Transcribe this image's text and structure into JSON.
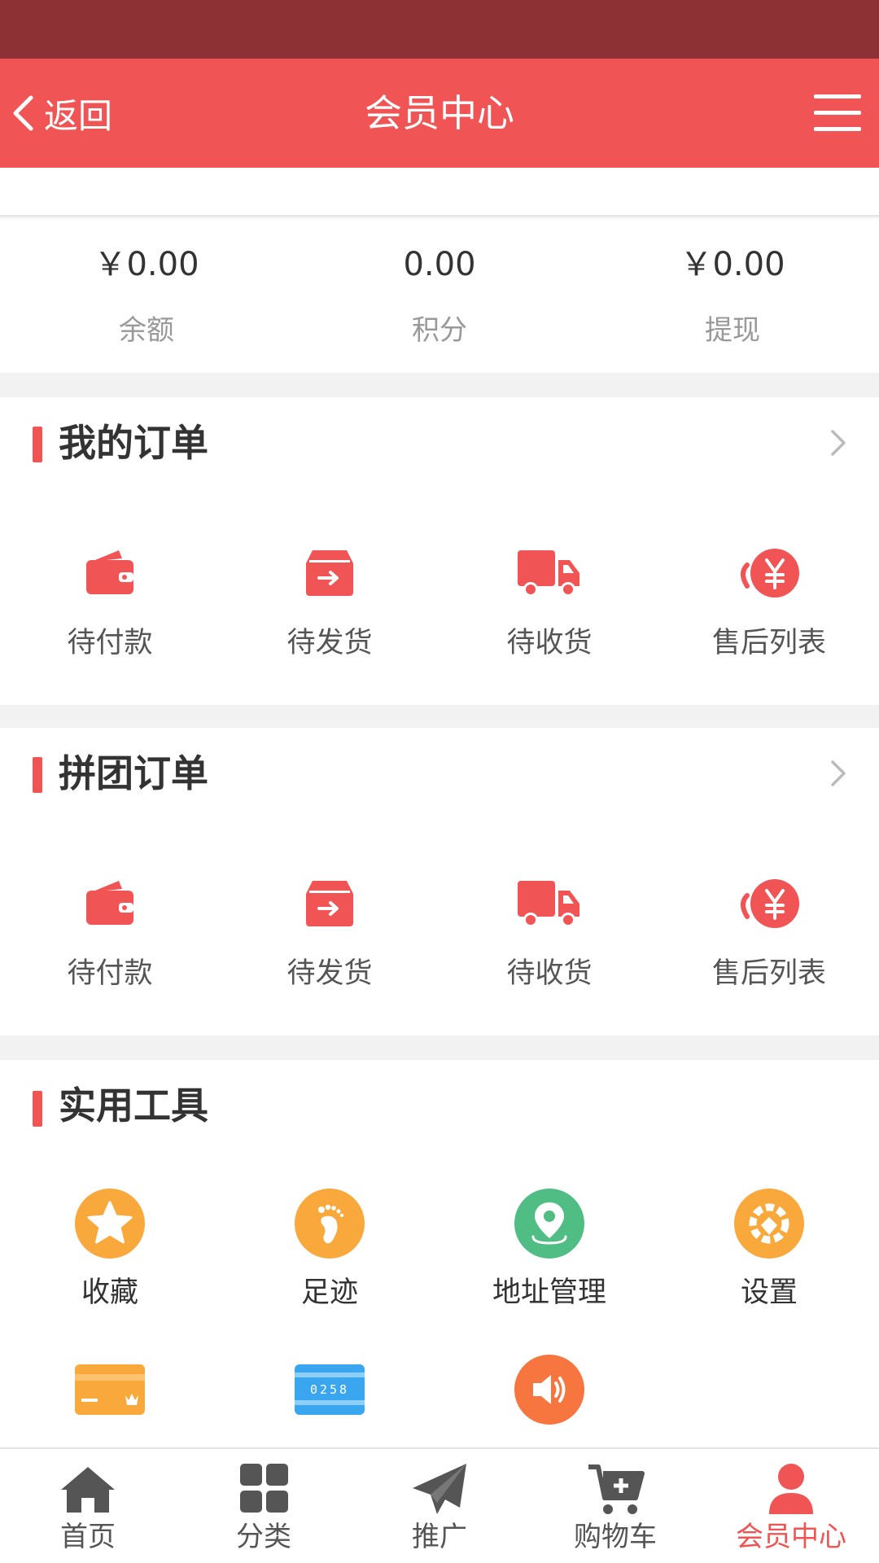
{
  "colors": {
    "accent": "#f05454",
    "statusbar": "#8e3134",
    "tool_orange": "#f9a83c",
    "tool_green": "#4fbd84",
    "tool_blue": "#3aa6f0",
    "tool_red_orange": "#f7753f"
  },
  "navbar": {
    "back_label": "返回",
    "title": "会员中心"
  },
  "stats": [
    {
      "value": "￥0.00",
      "label": "余额"
    },
    {
      "value": "0.00",
      "label": "积分"
    },
    {
      "value": "￥0.00",
      "label": "提现"
    }
  ],
  "orders": {
    "title": "我的订单",
    "items": [
      {
        "label": "待付款",
        "icon": "wallet-icon"
      },
      {
        "label": "待发货",
        "icon": "box-icon"
      },
      {
        "label": "待收货",
        "icon": "truck-icon"
      },
      {
        "label": "售后列表",
        "icon": "refund-icon"
      }
    ]
  },
  "group_orders": {
    "title": "拼团订单",
    "items": [
      {
        "label": "待付款",
        "icon": "wallet-icon"
      },
      {
        "label": "待发货",
        "icon": "box-icon"
      },
      {
        "label": "待收货",
        "icon": "truck-icon"
      },
      {
        "label": "售后列表",
        "icon": "refund-icon"
      }
    ]
  },
  "tools": {
    "title": "实用工具",
    "items": [
      {
        "label": "收藏",
        "icon": "star-icon"
      },
      {
        "label": "足迹",
        "icon": "footprint-icon"
      },
      {
        "label": "地址管理",
        "icon": "location-icon"
      },
      {
        "label": "设置",
        "icon": "settings-icon"
      }
    ],
    "more_items": [
      {
        "icon": "card-icon"
      },
      {
        "icon": "code-card-icon",
        "text": "0258"
      },
      {
        "icon": "speaker-icon"
      }
    ]
  },
  "tabbar": {
    "items": [
      {
        "label": "首页",
        "icon": "home-icon",
        "active": false
      },
      {
        "label": "分类",
        "icon": "grid-icon",
        "active": false
      },
      {
        "label": "推广",
        "icon": "paper-plane-icon",
        "active": false
      },
      {
        "label": "购物车",
        "icon": "cart-icon",
        "active": false
      },
      {
        "label": "会员中心",
        "icon": "user-icon",
        "active": true
      }
    ]
  }
}
